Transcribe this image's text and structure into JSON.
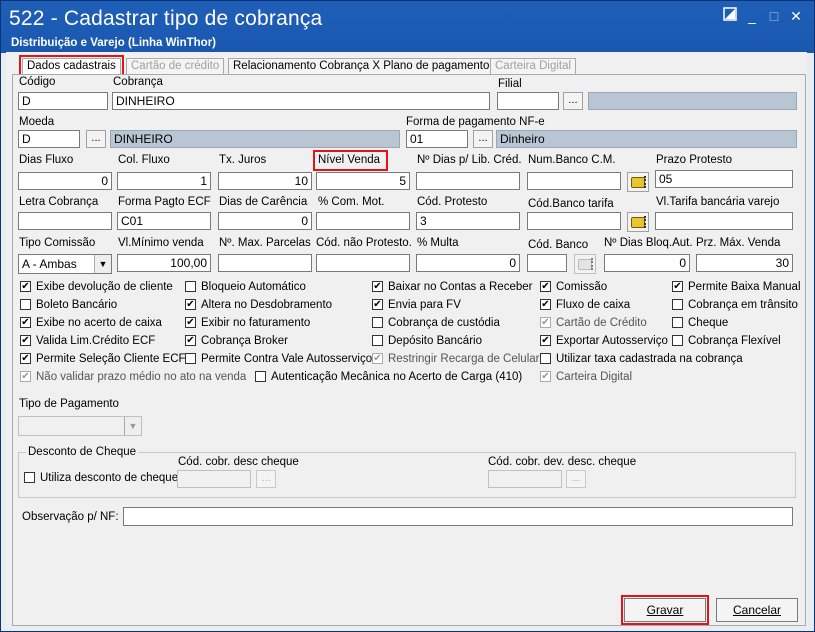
{
  "window": {
    "title": "522 - Cadastrar tipo de cobrança",
    "subtitle": "Distribuição e Varejo (Linha WinThor)",
    "restore_icon": "restore-icon",
    "minimize_glyph": "_",
    "maximize_glyph": "□",
    "close_glyph": "✕"
  },
  "tabs": [
    {
      "label": "Dados cadastrais"
    },
    {
      "label": "Cartão de crédito"
    },
    {
      "label": "Relacionamento Cobrança X Plano de pagamento"
    },
    {
      "label": "Carteira Digital"
    }
  ],
  "fields": {
    "codigo": {
      "label": "Código",
      "value": "D"
    },
    "cobranca": {
      "label": "Cobrança",
      "value": "DINHEIRO"
    },
    "filial": {
      "label": "Filial",
      "value": ""
    },
    "moeda": {
      "label": "Moeda",
      "code": "D",
      "desc": "DINHEIRO"
    },
    "forma_pgto_nfe": {
      "label": "Forma de pagamento NF-e",
      "code": "01",
      "desc": "Dinheiro"
    },
    "dias_fluxo": {
      "label": "Dias Fluxo",
      "value": "0"
    },
    "col_fluxo": {
      "label": "Col. Fluxo",
      "value": "1"
    },
    "tx_juros": {
      "label": "Tx. Juros",
      "value": "10"
    },
    "nivel_venda": {
      "label": "Nível Venda",
      "value": "5"
    },
    "dias_lib_cred": {
      "label": "Nº Dias p/ Lib. Créd.",
      "value": ""
    },
    "num_banco_cm": {
      "label": "Num.Banco C.M.",
      "value": ""
    },
    "prazo_protesto": {
      "label": "Prazo Protesto",
      "value": "05"
    },
    "letra_cobranca": {
      "label": "Letra Cobrança",
      "value": ""
    },
    "forma_pagto_ecf": {
      "label": "Forma Pagto ECF",
      "value": "C01"
    },
    "dias_carencia": {
      "label": "Dias de Carência",
      "value": "0"
    },
    "com_mot": {
      "label": "% Com. Mot.",
      "value": ""
    },
    "cod_protesto": {
      "label": "Cód. Protesto",
      "value": "3"
    },
    "cod_banco_tarifa": {
      "label": "Cód.Banco tarifa",
      "value": ""
    },
    "vl_tarifa": {
      "label": "Vl.Tarifa bancária varejo",
      "value": ""
    },
    "tipo_comissao": {
      "label": "Tipo Comissão",
      "value": "A - Ambas"
    },
    "vl_minimo": {
      "label": "Vl.Mínimo venda",
      "value": "100,00"
    },
    "max_parcelas": {
      "label": "Nº. Max. Parcelas",
      "value": ""
    },
    "cod_nao_protesto": {
      "label": "Cód. não Protesto.",
      "value": ""
    },
    "multa": {
      "label": "% Multa",
      "value": "0"
    },
    "cod_banco": {
      "label": "Cód. Banco",
      "value": ""
    },
    "dias_bloq": {
      "label": "Nº Dias Bloq.Aut.",
      "value": "0"
    },
    "prz_max_venda": {
      "label": "Prz. Máx. Venda",
      "value": "30"
    }
  },
  "checkboxes": [
    {
      "label": "Exibe devolução de cliente",
      "checked": true,
      "disabled": false
    },
    {
      "label": "Bloqueio Automático",
      "checked": false,
      "disabled": false
    },
    {
      "label": "Baixar no Contas a Receber",
      "checked": true,
      "disabled": false
    },
    {
      "label": "Comissão",
      "checked": true,
      "disabled": false
    },
    {
      "label": "Permite Baixa Manual",
      "checked": true,
      "disabled": false
    },
    {
      "label": "Boleto Bancário",
      "checked": false,
      "disabled": false
    },
    {
      "label": "Altera no Desdobramento",
      "checked": true,
      "disabled": false
    },
    {
      "label": "Envia para FV",
      "checked": true,
      "disabled": false
    },
    {
      "label": "Fluxo de caixa",
      "checked": true,
      "disabled": false
    },
    {
      "label": "Cobrança em trânsito",
      "checked": false,
      "disabled": false
    },
    {
      "label": "Exibe no acerto de caixa",
      "checked": true,
      "disabled": false
    },
    {
      "label": "Exibir no faturamento",
      "checked": true,
      "disabled": false
    },
    {
      "label": "Cobrança de custódia",
      "checked": false,
      "disabled": false
    },
    {
      "label": "Cartão de Crédito",
      "checked": true,
      "disabled": true
    },
    {
      "label": "Cheque",
      "checked": false,
      "disabled": false
    },
    {
      "label": "Valida Lim.Crédito ECF",
      "checked": true,
      "disabled": false
    },
    {
      "label": "Cobrança Broker",
      "checked": true,
      "disabled": false
    },
    {
      "label": "Depósito Bancário",
      "checked": false,
      "disabled": false
    },
    {
      "label": "Exportar Autosserviço",
      "checked": true,
      "disabled": false
    },
    {
      "label": "Cobrança Flexível",
      "checked": false,
      "disabled": false
    },
    {
      "label": "Permite Seleção Cliente ECF",
      "checked": true,
      "disabled": false
    },
    {
      "label": "Permite Contra Vale Autosserviço",
      "checked": false,
      "disabled": false
    },
    {
      "label": "Restringir Recarga de Celular",
      "checked": true,
      "disabled": true
    },
    {
      "label": "Utilizar taxa cadastrada na cobrança",
      "checked": false,
      "disabled": false
    },
    {
      "label": "Não validar prazo médio no ato na venda",
      "checked": true,
      "disabled": true
    },
    {
      "label": "Autenticação Mecânica no Acerto de Carga (410)",
      "checked": false,
      "disabled": false
    },
    {
      "label": "Carteira Digital",
      "checked": true,
      "disabled": true
    }
  ],
  "tipo_pagamento": {
    "label": "Tipo de Pagamento",
    "value": ""
  },
  "desconto_cheque": {
    "group_label": "Desconto de Cheque",
    "utiliza_label": "Utiliza desconto de cheque",
    "cod_cobr_desc_label": "Cód. cobr. desc cheque",
    "cod_cobr_dev_label": "Cód. cobr. dev. desc. cheque"
  },
  "observacao": {
    "label": "Observação p/ NF:",
    "value": ""
  },
  "buttons": {
    "gravar": "Gravar",
    "cancelar": "Cancelar",
    "ellipsis": "..."
  },
  "colors": {
    "highlight": "#e1141b",
    "title_bar": "#1f5fb8"
  }
}
